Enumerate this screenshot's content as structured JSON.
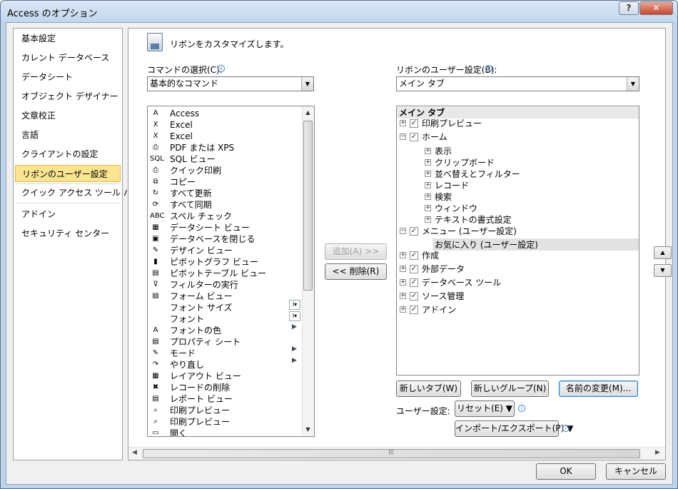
{
  "window": {
    "title": "Access のオプション",
    "help": "?",
    "close": "✕"
  },
  "nav": {
    "items": [
      "基本設定",
      "カレント データベース",
      "データシート",
      "オブジェクト デザイナー",
      "文章校正",
      "言語",
      "クライアントの設定",
      "リボンのユーザー設定",
      "クイック アクセス ツール バー",
      "アドイン",
      "セキュリティ センター"
    ],
    "selected": "リボンのユーザー設定"
  },
  "header": {
    "text": "リボンをカスタマイズします。"
  },
  "left": {
    "label": "コマンドの選択(C):",
    "combo": "基本的なコマンド",
    "commands": [
      "Access",
      "Excel",
      "Excel",
      "PDF または XPS",
      "SQL ビュー",
      "クイック印刷",
      "コピー",
      "すべて更新",
      "すべて同期",
      "スペル チェック",
      "データシート ビュー",
      "データベースを閉じる",
      "デザイン ビュー",
      "ピボットグラフ ビュー",
      "ピボットテーブル ビュー",
      "フィルターの実行",
      "フォーム ビュー",
      "フォント サイズ",
      "フォント",
      "フォントの色",
      "プロパティ シート",
      "モード",
      "やり直し",
      "レイアウト ビュー",
      "レコードの削除",
      "レポート ビュー",
      "印刷プレビュー",
      "印刷プレビュー",
      "開く"
    ],
    "icons": [
      "access-icon",
      "excel-icon",
      "excel-icon",
      "pdf-icon",
      "sql-icon",
      "quick-print-icon",
      "copy-icon",
      "refresh-all-icon",
      "sync-all-icon",
      "spell-check-icon",
      "datasheet-icon",
      "close-database-icon",
      "design-view-icon",
      "pivotchart-icon",
      "pivottable-icon",
      "filter-icon",
      "form-view-icon",
      "blank-icon",
      "blank-icon",
      "font-color-icon",
      "property-sheet-icon",
      "mode-icon",
      "redo-icon",
      "layout-view-icon",
      "delete-record-icon",
      "report-view-icon",
      "print-preview-icon",
      "print-preview-icon",
      "open-icon"
    ],
    "icon_glyphs": [
      "A",
      "X",
      "X",
      "⎙",
      "SQL",
      "⎙",
      "⧉",
      "↻",
      "⟳",
      "ABC",
      "▦",
      "▣",
      "✎",
      "▮",
      "▤",
      "⊽",
      "▤",
      "",
      "",
      "A",
      "▤",
      "✎",
      "↷",
      "▦",
      "✖",
      "▤",
      "⌕",
      "⌕",
      "▭"
    ]
  },
  "buttons": {
    "add": "追加(A) >>",
    "remove": "<< 削除(R)"
  },
  "right": {
    "label": "リボンのユーザー設定(B):",
    "combo": "メイン タブ",
    "tree_header": "メイン タブ",
    "tree": [
      {
        "text": "印刷プレビュー",
        "level": 0,
        "exp": "+",
        "chk": true
      },
      {
        "text": "ホーム",
        "level": 0,
        "exp": "−",
        "chk": true
      },
      {
        "text": "表示",
        "level": 1,
        "exp": "+"
      },
      {
        "text": "クリップボード",
        "level": 1,
        "exp": "+"
      },
      {
        "text": "並べ替えとフィルター",
        "level": 1,
        "exp": "+"
      },
      {
        "text": "レコード",
        "level": 1,
        "exp": "+"
      },
      {
        "text": "検索",
        "level": 1,
        "exp": "+"
      },
      {
        "text": "ウィンドウ",
        "level": 1,
        "exp": "+"
      },
      {
        "text": "テキストの書式設定",
        "level": 1,
        "exp": "+"
      },
      {
        "text": "メニュー (ユーザー設定)",
        "level": 0,
        "exp": "−",
        "chk": true
      },
      {
        "text": "お気に入り (ユーザー設定)",
        "level": 2,
        "sel": true
      },
      {
        "text": "作成",
        "level": 0,
        "exp": "+",
        "chk": true
      },
      {
        "text": "外部データ",
        "level": 0,
        "exp": "+",
        "chk": true
      },
      {
        "text": "データベース ツール",
        "level": 0,
        "exp": "+",
        "chk": true
      },
      {
        "text": "ソース管理",
        "level": 0,
        "exp": "+",
        "chk": true
      },
      {
        "text": "アドイン",
        "level": 0,
        "exp": "+",
        "chk": true
      }
    ],
    "new_tab": "新しいタブ(W)",
    "new_group": "新しいグループ(N)",
    "rename": "名前の変更(M)...",
    "user_settings": "ユーザー設定:",
    "reset": "リセット(E) ▼",
    "import_export": "インポート/エクスポート(P) ▼"
  },
  "footer": {
    "ok": "OK",
    "cancel": "キャンセル"
  }
}
